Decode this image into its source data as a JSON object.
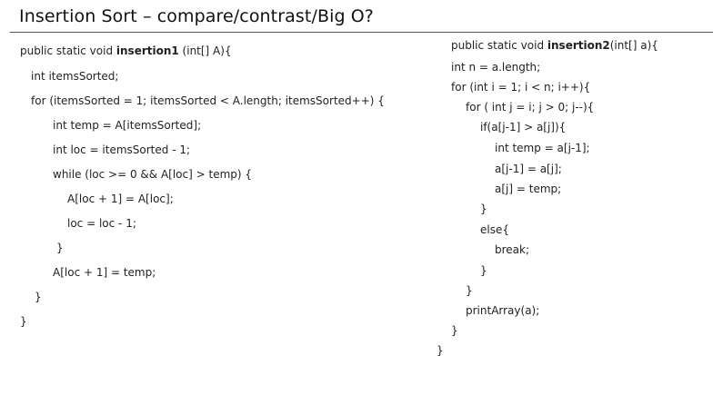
{
  "slide": {
    "title": "Insertion Sort – compare/contrast/Big O?"
  },
  "left_code": {
    "lines": [
      {
        "pre": "public static void ",
        "bold": "insertion1",
        "post": " (int[] A){"
      },
      {
        "pre": "int itemsSorted;",
        "bold": "",
        "post": ""
      },
      {
        "pre": "for (itemsSorted = 1; itemsSorted < A.length; itemsSorted++) {",
        "bold": "",
        "post": ""
      },
      {
        "pre": "int temp = A[itemsSorted];",
        "bold": "",
        "post": ""
      },
      {
        "pre": "int loc = itemsSorted - 1;",
        "bold": "",
        "post": ""
      },
      {
        "pre": "while (loc >= 0 && A[loc] > temp) {",
        "bold": "",
        "post": ""
      },
      {
        "pre": "A[loc + 1] = A[loc];",
        "bold": "",
        "post": ""
      },
      {
        "pre": "loc = loc - 1;",
        "bold": "",
        "post": ""
      },
      {
        "pre": "}",
        "bold": "",
        "post": ""
      },
      {
        "pre": "A[loc + 1] = temp;",
        "bold": "",
        "post": ""
      },
      {
        "pre": "}",
        "bold": "",
        "post": ""
      },
      {
        "pre": "}",
        "bold": "",
        "post": ""
      }
    ]
  },
  "right_code": {
    "lines": [
      {
        "pre": "public static void ",
        "bold": "insertion2",
        "post": "(int[] a){"
      },
      {
        "pre": "int n = a.length;",
        "bold": "",
        "post": ""
      },
      {
        "pre": "for (int i = 1; i < n; i++){",
        "bold": "",
        "post": ""
      },
      {
        "pre": "for ( int j = i; j > 0; j--){",
        "bold": "",
        "post": ""
      },
      {
        "pre": "if(a[j-1] > a[j]){",
        "bold": "",
        "post": ""
      },
      {
        "pre": "int temp = a[j-1];",
        "bold": "",
        "post": ""
      },
      {
        "pre": "a[j-1] = a[j];",
        "bold": "",
        "post": ""
      },
      {
        "pre": "a[j] = temp;",
        "bold": "",
        "post": ""
      },
      {
        "pre": "}",
        "bold": "",
        "post": ""
      },
      {
        "pre": "else{",
        "bold": "",
        "post": ""
      },
      {
        "pre": "break;",
        "bold": "",
        "post": ""
      },
      {
        "pre": "}",
        "bold": "",
        "post": ""
      },
      {
        "pre": "}",
        "bold": "",
        "post": ""
      },
      {
        "pre": "printArray(a);",
        "bold": "",
        "post": ""
      },
      {
        "pre": "}",
        "bold": "",
        "post": ""
      },
      {
        "pre": "}",
        "bold": "",
        "post": ""
      }
    ]
  }
}
